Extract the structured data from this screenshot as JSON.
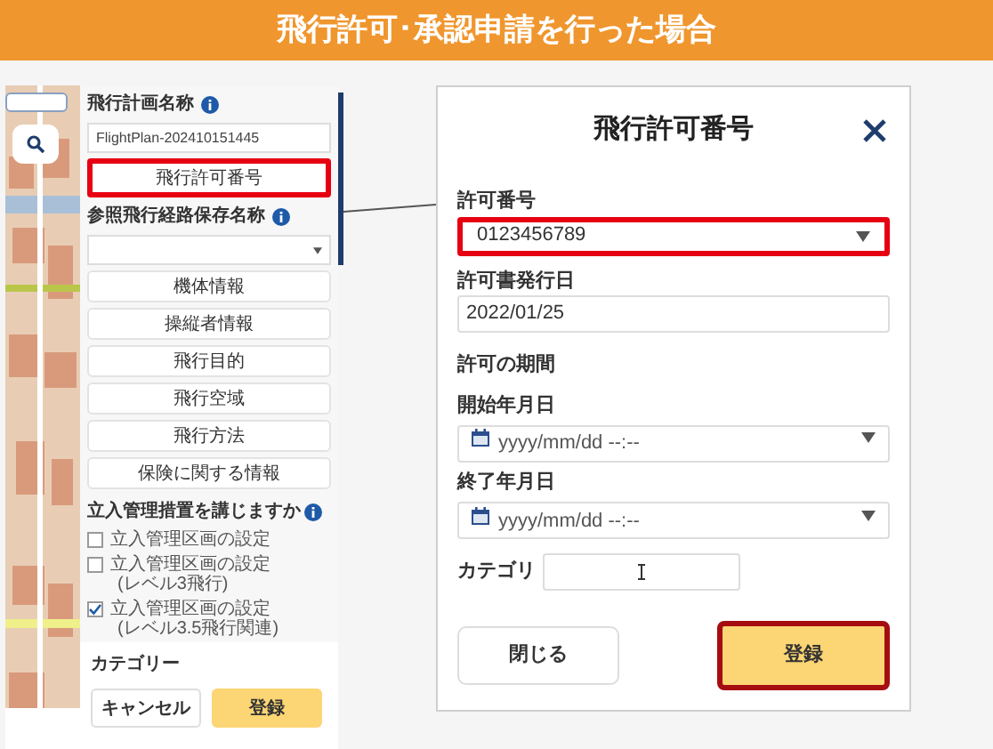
{
  "banner": {
    "title": "飛行許可･承認申請を行った場合"
  },
  "sidebar": {
    "plan_name": {
      "label": "飛行計画名称",
      "value": "FlightPlan-202410151445"
    },
    "permit_button": {
      "label": "飛行許可番号",
      "highlighted": true
    },
    "route": {
      "label": "参照飛行経路保存名称"
    },
    "section_buttons": [
      "機体情報",
      "操縦者情報",
      "飛行目的",
      "飛行空域",
      "飛行方法",
      "保険に関する情報"
    ],
    "measures": {
      "label": "立入管理措置を講じますか",
      "options": [
        {
          "label": "立入管理区画の設定",
          "checked": false
        },
        {
          "label": "立入管理区画の設定",
          "sub": "(レベル3飛行)",
          "checked": false
        },
        {
          "label": "立入管理区画の設定",
          "sub": "(レベル3.5飛行関連)",
          "checked": true
        }
      ]
    },
    "category_label": "カテゴリー",
    "cancel": "キャンセル",
    "submit": "登録"
  },
  "dialog": {
    "title": "飛行許可番号",
    "permit_number": {
      "label": "許可番号",
      "value": "0123456789",
      "highlighted": true
    },
    "issue_date": {
      "label": "許可書発行日",
      "value": "2022/01/25"
    },
    "period_label": "許可の期間",
    "start": {
      "label": "開始年月日",
      "placeholder": "yyyy/mm/dd --:--"
    },
    "end": {
      "label": "終了年月日",
      "placeholder": "yyyy/mm/dd --:--"
    },
    "category": {
      "label": "カテゴリ"
    },
    "close": {
      "label": "閉じる"
    },
    "submit": {
      "label": "登録",
      "highlighted": true
    }
  }
}
